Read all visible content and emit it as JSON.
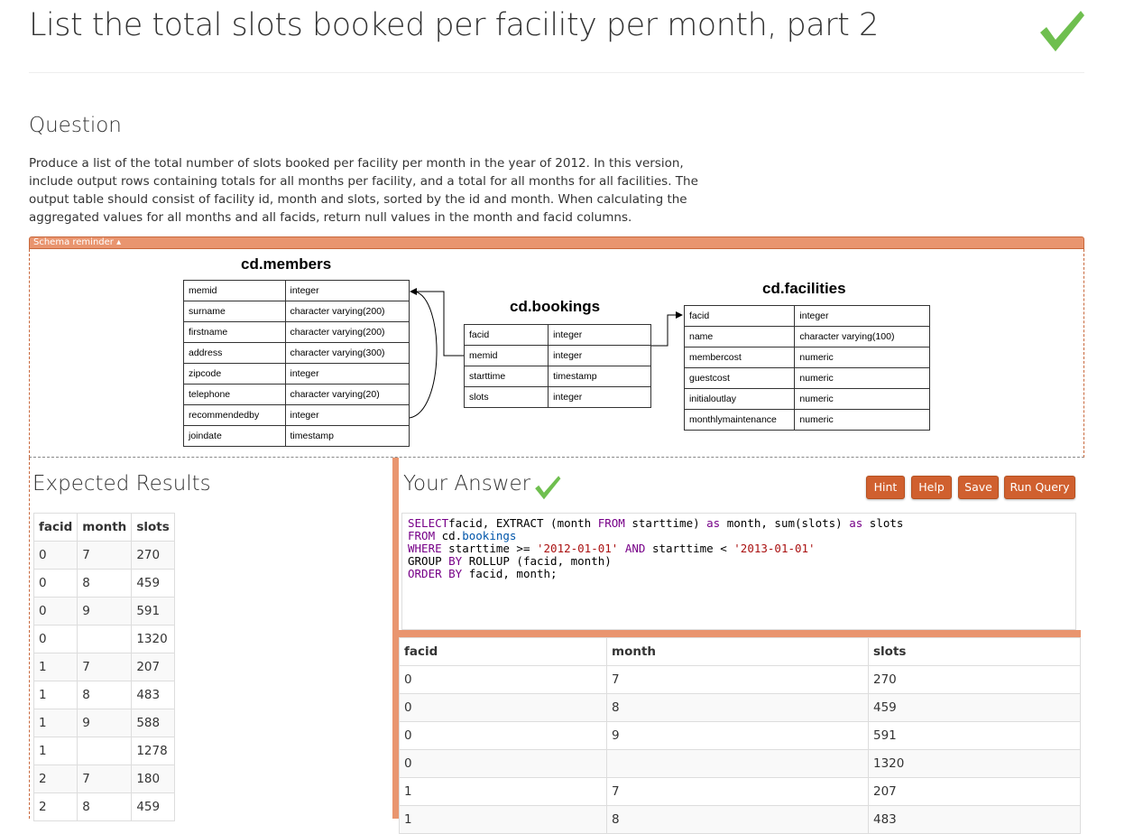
{
  "title": "List the total slots booked per facility per month, part 2",
  "question": {
    "heading": "Question",
    "text": "Produce a list of the total number of slots booked per facility per month in the year of 2012. In this version, include output rows containing totals for all months per facility, and a total for all months for all facilities. The output table should consist of facility id, month and slots, sorted by the id and month. When calculating the aggregated values for all months and all facids, return null values in the month and facid columns."
  },
  "schema": {
    "toggle": "Schema reminder ▴",
    "members": {
      "name": "cd.members",
      "rows": [
        [
          "memid",
          "integer"
        ],
        [
          "surname",
          "character varying(200)"
        ],
        [
          "firstname",
          "character varying(200)"
        ],
        [
          "address",
          "character varying(300)"
        ],
        [
          "zipcode",
          "integer"
        ],
        [
          "telephone",
          "character varying(20)"
        ],
        [
          "recommendedby",
          "integer"
        ],
        [
          "joindate",
          "timestamp"
        ]
      ]
    },
    "bookings": {
      "name": "cd.bookings",
      "rows": [
        [
          "facid",
          "integer"
        ],
        [
          "memid",
          "integer"
        ],
        [
          "starttime",
          "timestamp"
        ],
        [
          "slots",
          "integer"
        ]
      ]
    },
    "facilities": {
      "name": "cd.facilities",
      "rows": [
        [
          "facid",
          "integer"
        ],
        [
          "name",
          "character varying(100)"
        ],
        [
          "membercost",
          "numeric"
        ],
        [
          "guestcost",
          "numeric"
        ],
        [
          "initialoutlay",
          "numeric"
        ],
        [
          "monthlymaintenance",
          "numeric"
        ]
      ]
    }
  },
  "expected": {
    "heading": "Expected Results",
    "columns": [
      "facid",
      "month",
      "slots"
    ],
    "rows": [
      [
        "0",
        "7",
        "270"
      ],
      [
        "0",
        "8",
        "459"
      ],
      [
        "0",
        "9",
        "591"
      ],
      [
        "0",
        "",
        "1320"
      ],
      [
        "1",
        "7",
        "207"
      ],
      [
        "1",
        "8",
        "483"
      ],
      [
        "1",
        "9",
        "588"
      ],
      [
        "1",
        "",
        "1278"
      ],
      [
        "2",
        "7",
        "180"
      ],
      [
        "2",
        "8",
        "459"
      ]
    ]
  },
  "answer": {
    "heading": "Your Answer",
    "buttons": {
      "hint": "Hint",
      "help": "Help",
      "save": "Save",
      "run": "Run Query"
    },
    "query": [
      [
        "kw",
        "SELECT"
      ],
      [
        "",
        "facid, EXTRACT (month "
      ],
      [
        "kw",
        "FROM"
      ],
      [
        "",
        " starttime) "
      ],
      [
        "kw",
        "as"
      ],
      [
        "",
        " month, sum(slots) "
      ],
      [
        "kw",
        "as"
      ],
      [
        "",
        " slots\n"
      ],
      [
        "kw",
        "FROM"
      ],
      [
        "",
        " cd."
      ],
      [
        "var",
        "bookings"
      ],
      [
        "",
        "\n"
      ],
      [
        "kw",
        "WHERE"
      ],
      [
        "",
        " starttime >= "
      ],
      [
        "str",
        "'2012-01-01'"
      ],
      [
        "",
        " "
      ],
      [
        "kw",
        "AND"
      ],
      [
        "",
        " starttime < "
      ],
      [
        "str",
        "'2013-01-01'"
      ],
      [
        "",
        "\nGROUP "
      ],
      [
        "kw",
        "BY"
      ],
      [
        "",
        " ROLLUP (facid, month)\n"
      ],
      [
        "kw",
        "ORDER BY"
      ],
      [
        "",
        " facid, month;"
      ]
    ],
    "columns": [
      "facid",
      "month",
      "slots"
    ],
    "rows": [
      [
        "0",
        "7",
        "270"
      ],
      [
        "0",
        "8",
        "459"
      ],
      [
        "0",
        "9",
        "591"
      ],
      [
        "0",
        "",
        "1320"
      ],
      [
        "1",
        "7",
        "207"
      ],
      [
        "1",
        "8",
        "483"
      ]
    ]
  },
  "colors": {
    "accent": "#d0602f",
    "check": "#5cb85c"
  }
}
